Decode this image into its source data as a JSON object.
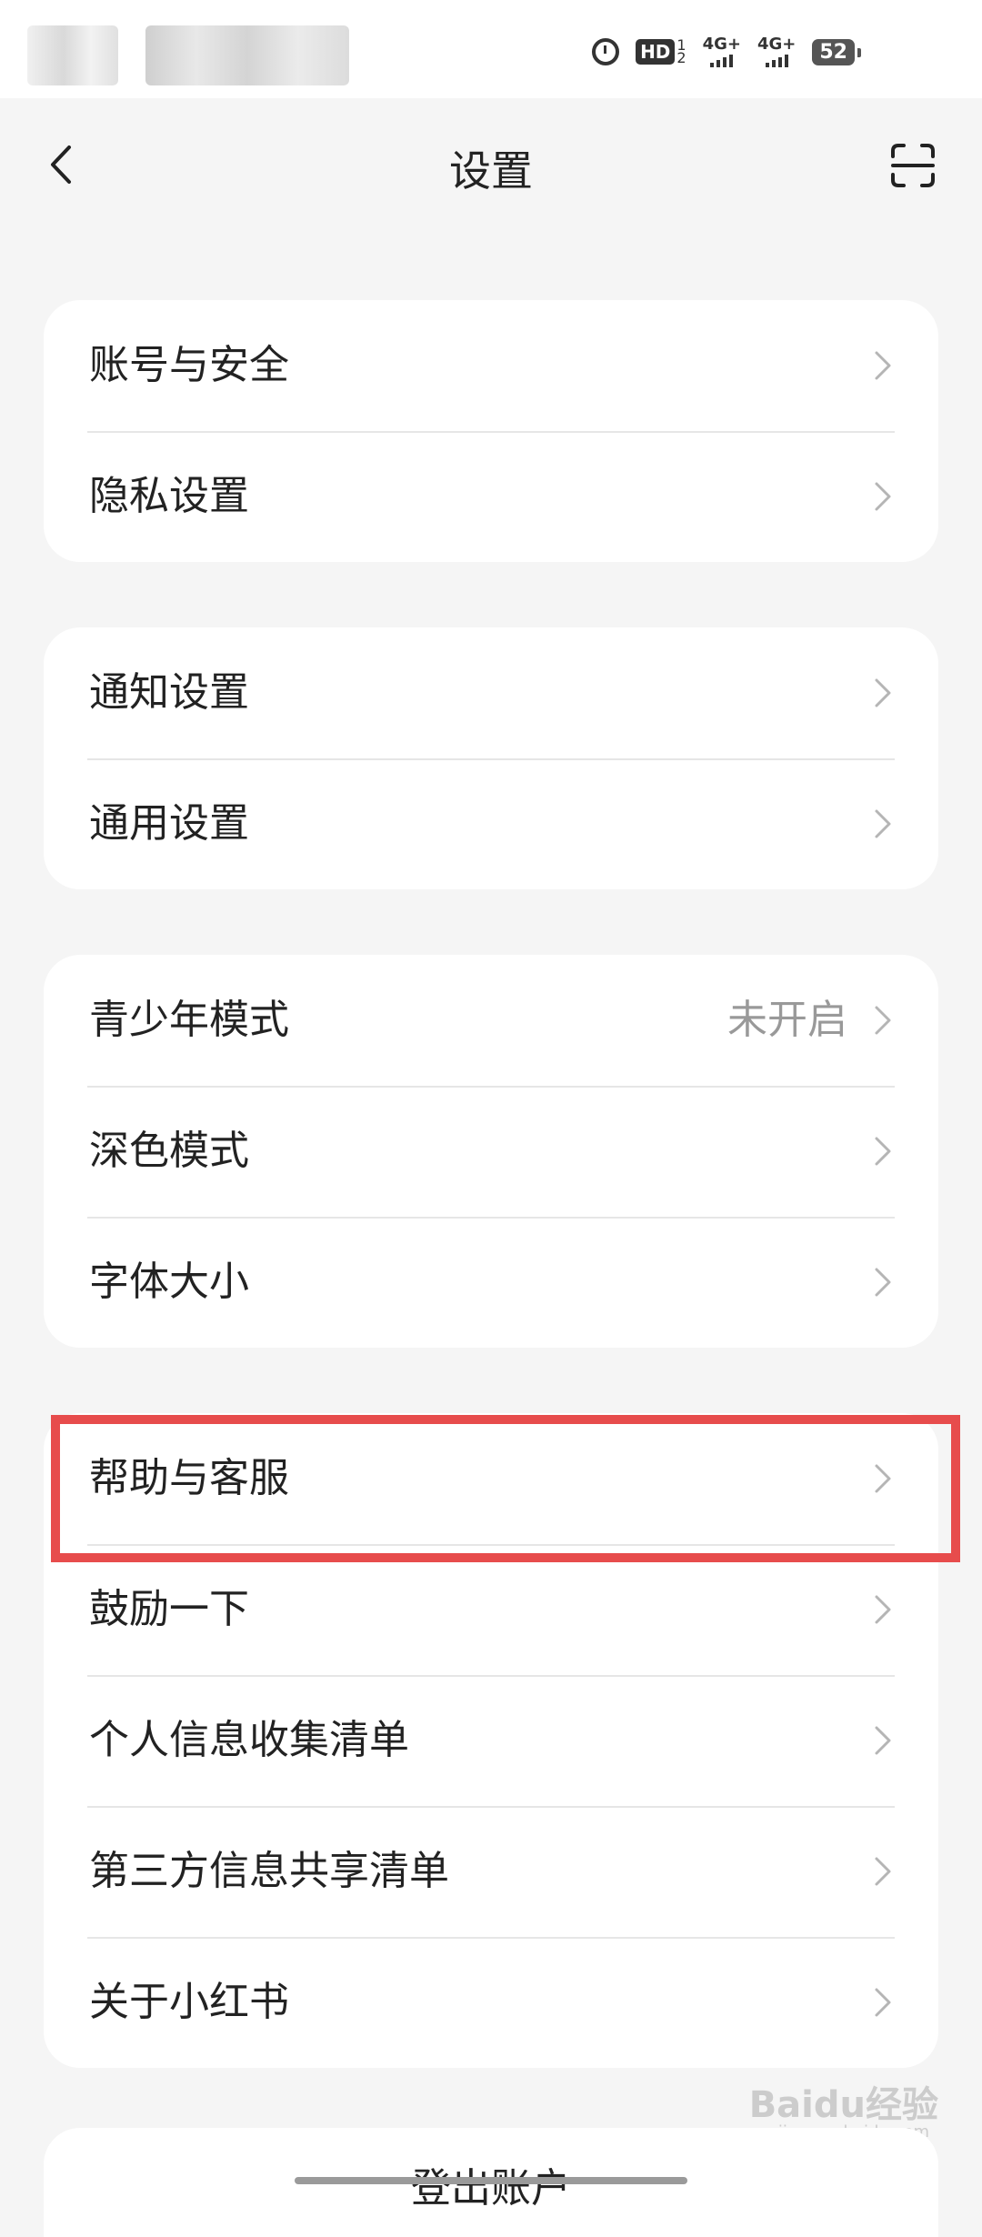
{
  "status_bar": {
    "hd_label": "HD",
    "sim_top": "1",
    "sim_bottom": "2",
    "net1": "4G+",
    "net2": "4G+",
    "battery": "52"
  },
  "header": {
    "title": "设置"
  },
  "groups": [
    {
      "items": [
        {
          "label": "账号与安全",
          "value": ""
        },
        {
          "label": "隐私设置",
          "value": ""
        }
      ]
    },
    {
      "items": [
        {
          "label": "通知设置",
          "value": ""
        },
        {
          "label": "通用设置",
          "value": ""
        }
      ]
    },
    {
      "items": [
        {
          "label": "青少年模式",
          "value": "未开启"
        },
        {
          "label": "深色模式",
          "value": ""
        },
        {
          "label": "字体大小",
          "value": ""
        }
      ]
    },
    {
      "items": [
        {
          "label": "帮助与客服",
          "value": ""
        },
        {
          "label": "鼓励一下",
          "value": ""
        },
        {
          "label": "个人信息收集清单",
          "value": ""
        },
        {
          "label": "第三方信息共享清单",
          "value": ""
        },
        {
          "label": "关于小红书",
          "value": ""
        }
      ]
    }
  ],
  "logout": {
    "label": "登出账户"
  },
  "watermark": {
    "text": "Baidu经验",
    "sub": "jingyan.baidu.com"
  }
}
